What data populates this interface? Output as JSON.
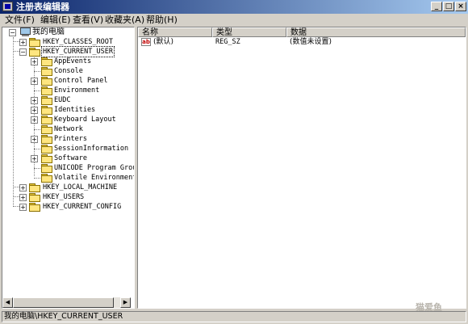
{
  "window": {
    "title": "注册表编辑器",
    "buttons": {
      "minimize": "_",
      "maximize": "□",
      "close": "×"
    }
  },
  "menu": [
    {
      "label": "文件(F)"
    },
    {
      "label": "编辑(E)"
    },
    {
      "label": "查看(V)"
    },
    {
      "label": "收藏夹(A)"
    },
    {
      "label": "帮助(H)"
    }
  ],
  "tree": {
    "root": "我的电脑",
    "items": [
      {
        "label": "HKEY_CLASSES_ROOT",
        "expander": "+"
      },
      {
        "label": "HKEY_CURRENT_USER",
        "expander": "−",
        "selected": true
      },
      {
        "label": "AppEvents",
        "expander": "+"
      },
      {
        "label": "Console",
        "expander": ""
      },
      {
        "label": "Control Panel",
        "expander": "+"
      },
      {
        "label": "Environment",
        "expander": ""
      },
      {
        "label": "EUDC",
        "expander": "+"
      },
      {
        "label": "Identities",
        "expander": "+"
      },
      {
        "label": "Keyboard Layout",
        "expander": "+"
      },
      {
        "label": "Network",
        "expander": ""
      },
      {
        "label": "Printers",
        "expander": "+"
      },
      {
        "label": "SessionInformation",
        "expander": ""
      },
      {
        "label": "Software",
        "expander": "+"
      },
      {
        "label": "UNICODE Program Groups",
        "expander": ""
      },
      {
        "label": "Volatile Environment",
        "expander": ""
      },
      {
        "label": "HKEY_LOCAL_MACHINE",
        "expander": "+"
      },
      {
        "label": "HKEY_USERS",
        "expander": "+"
      },
      {
        "label": "HKEY_CURRENT_CONFIG",
        "expander": "+"
      }
    ]
  },
  "list": {
    "columns": [
      "名称",
      "类型",
      "数据"
    ],
    "rows": [
      {
        "name": "(默认)",
        "type": "REG_SZ",
        "data": "(数值未设置)"
      }
    ]
  },
  "status": "我的电脑\\HKEY_CURRENT_USER",
  "watermark": "猫爱鱼",
  "colors": {
    "titlebar": "#0a246a",
    "face": "#d4d0c8"
  }
}
